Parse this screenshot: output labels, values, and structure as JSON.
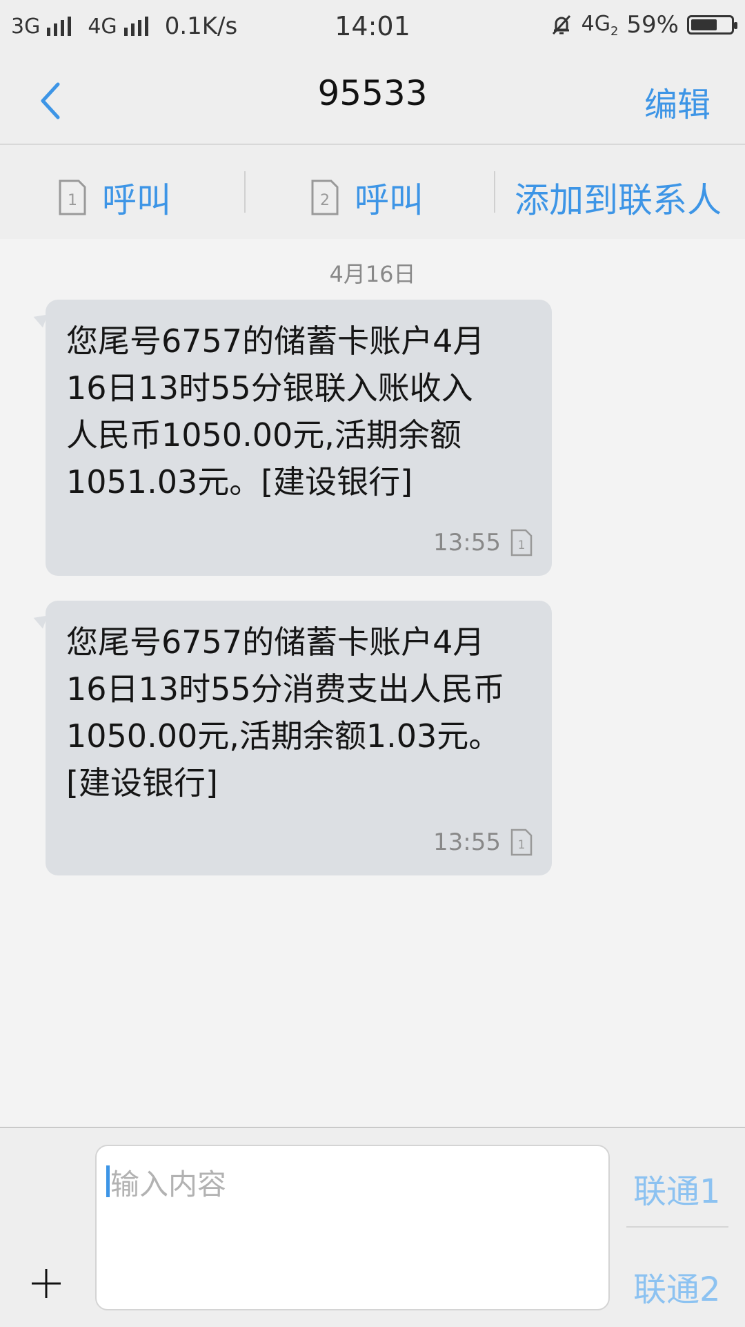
{
  "status_bar": {
    "net1": "3G",
    "net2": "4G",
    "speed": "0.1K/s",
    "time": "14:01",
    "net_right": "4G",
    "net_right_sub": "2",
    "battery_text": "59%",
    "battery_level": 0.59
  },
  "header": {
    "title": "95533",
    "edit_label": "编辑"
  },
  "actions": {
    "call1_label": "呼叫",
    "call2_label": "呼叫",
    "sim1_number": "1",
    "sim2_number": "2",
    "add_contact_label": "添加到联系人"
  },
  "conversation": {
    "date": "4月16日",
    "messages": [
      {
        "text": "您尾号6757的储蓄卡账户4月\n16日13时55分银联入账收入\n人民币1050.00元,活期余额\n1051.03元。[建设银行]",
        "time": "13:55",
        "sim": "1"
      },
      {
        "text": "您尾号6757的储蓄卡账户4月\n16日13时55分消费支出人民币\n1050.00元,活期余额1.03元。\n[建设银行]",
        "time": "13:55",
        "sim": "1"
      }
    ]
  },
  "composer": {
    "placeholder": "输入内容",
    "send_sim1": "联通1",
    "send_sim2": "联通2"
  },
  "colors": {
    "accent": "#3d95e6",
    "bubble": "#dcdfe3",
    "send_label": "#8cc2f1"
  }
}
